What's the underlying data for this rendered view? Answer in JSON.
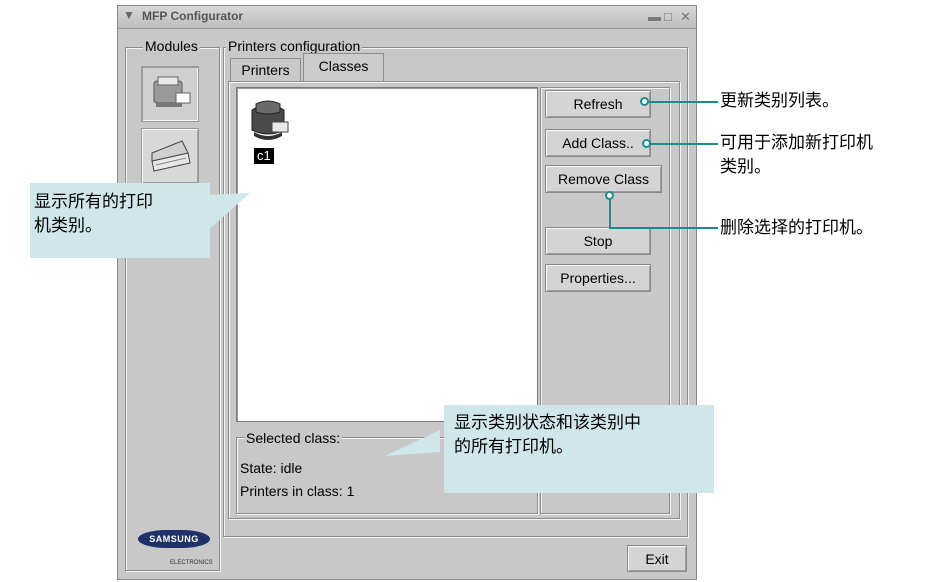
{
  "window": {
    "title": "MFP Configurator"
  },
  "modules": {
    "label": "Modules"
  },
  "printers_config": {
    "label": "Printers configuration",
    "tabs": [
      {
        "label": "Printers",
        "active": false
      },
      {
        "label": "Classes",
        "active": true
      }
    ],
    "class_items": [
      {
        "name": "c1"
      }
    ],
    "buttons": {
      "refresh": "Refresh",
      "add_class": "Add Class..",
      "remove_class": "Remove Class",
      "stop": "Stop",
      "properties": "Properties..."
    },
    "selected_class": {
      "label": "Selected class:",
      "state": "State: idle",
      "printers": "Printers in class: 1"
    }
  },
  "exit_label": "Exit",
  "brand": {
    "name": "SAMSUNG",
    "sub": "ELECTRONICS"
  },
  "annotations": {
    "refresh_note": "更新类别列表。",
    "add_note_line1": "可用于添加新打印机",
    "add_note_line2": "类别。",
    "remove_note": "删除选择的打印机。",
    "left_callout_line1": "显示所有的打印",
    "left_callout_line2": "机类别。",
    "bottom_callout_line1": "显示类别状态和该类别中",
    "bottom_callout_line2": "的所有打印机。"
  },
  "colors": {
    "accent": "#1d8a8e",
    "callout_bg": "#cfe6ea",
    "window_bg": "#c8c8c8"
  }
}
